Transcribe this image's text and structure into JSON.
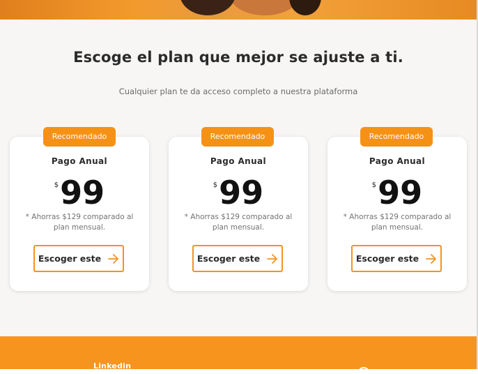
{
  "header": {
    "title": "Escoge el plan que mejor se ajuste a ti.",
    "subtitle": "Cualquier plan te da acceso completo a nuestra plataforma"
  },
  "plans": [
    {
      "badge": "Recomendado",
      "name": "Pago Anual",
      "currency": "$",
      "price": "99",
      "note": "* Ahorras $129 comparado al plan mensual.",
      "button_label": "Escoger este",
      "button_icon": "arrow-right-icon"
    },
    {
      "badge": "Recomendado",
      "name": "Pago Anual",
      "currency": "$",
      "price": "99",
      "note": "* Ahorras $129 comparado al plan mensual.",
      "button_label": "Escoger este",
      "button_icon": "arrow-right-icon"
    },
    {
      "badge": "Recomendado",
      "name": "Pago Anual",
      "currency": "$",
      "price": "99",
      "note": "* Ahorras $129 comparado al plan mensual.",
      "button_label": "Escoger este",
      "button_icon": "arrow-right-icon"
    }
  ],
  "footer": {
    "link_label": "Linkedin"
  },
  "colors": {
    "accent": "#f59216",
    "section_bg": "#f7f6f5",
    "title": "#2b2b2b"
  }
}
